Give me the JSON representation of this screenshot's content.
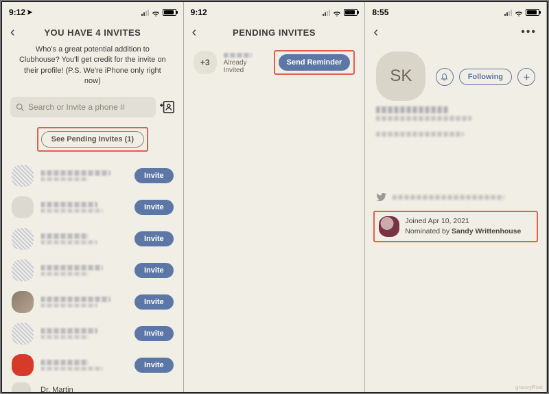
{
  "status": {
    "time1": "9:12",
    "time2": "9:12",
    "time3": "8:55"
  },
  "screen1": {
    "title": "YOU HAVE 4 INVITES",
    "subtitle": "Who's a great potential addition to Clubhouse? You'll get credit for the invite on their profile! (P.S. We're iPhone only right now)",
    "search_placeholder": "Search or Invite a phone #",
    "pending_btn": "See Pending Invites (1)",
    "invite_label": "Invite",
    "contacts": [
      {
        "style": "pix"
      },
      {
        "style": ""
      },
      {
        "style": "pix"
      },
      {
        "style": "pix"
      },
      {
        "style": "photo"
      },
      {
        "style": "pix"
      },
      {
        "style": "red"
      }
    ],
    "last_name": "Dr. Martin"
  },
  "screen2": {
    "title": "PENDING INVITES",
    "plus_badge": "+3",
    "already": "Already Invited",
    "reminder": "Send Reminder"
  },
  "screen3": {
    "initials": "SK",
    "following": "Following",
    "joined": "Joined Apr 10, 2021",
    "nominated_prefix": "Nominated by ",
    "nominated_name": "Sandy Writtenhouse"
  },
  "watermark": "groovyPost"
}
